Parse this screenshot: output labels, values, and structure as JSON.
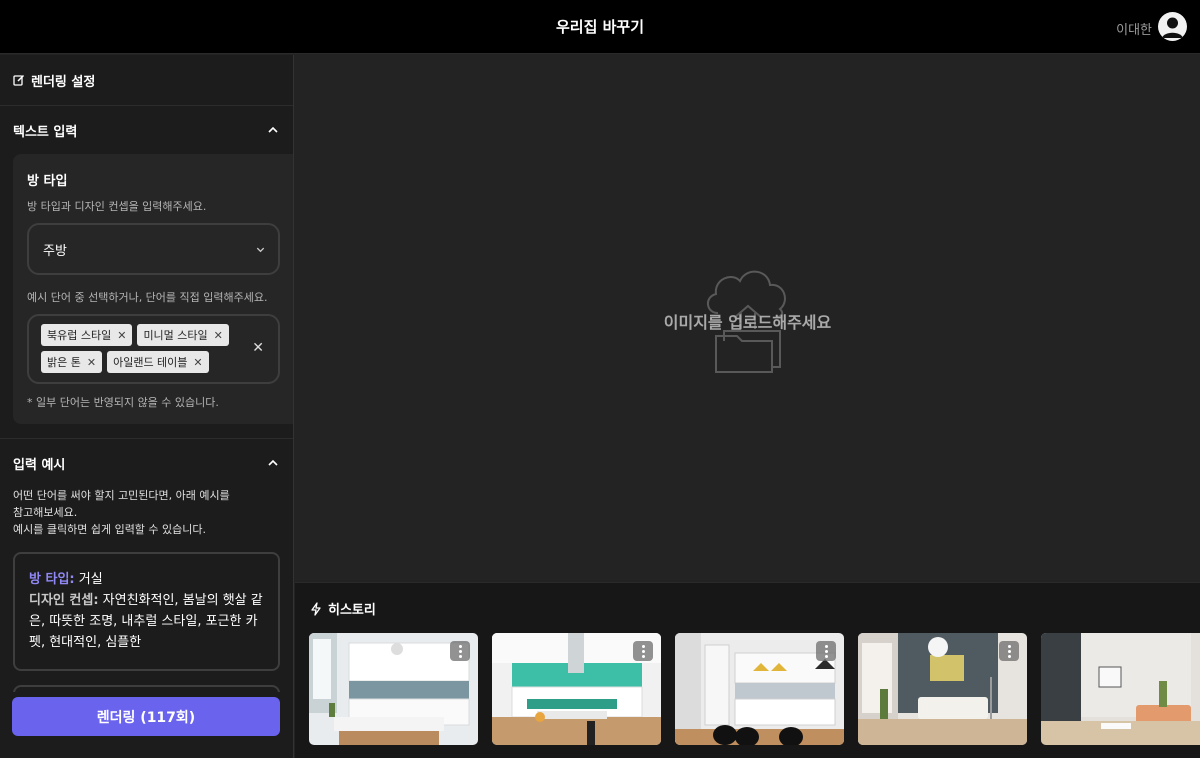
{
  "header": {
    "title": "우리집 바꾸기",
    "user_name": "이대한"
  },
  "sidebar": {
    "title": "렌더링 설정",
    "text_input": {
      "section_title": "텍스트 입력",
      "room_type_title": "방 타입",
      "room_type_hint": "방 타입과 디자인 컨셉을 입력해주세요.",
      "room_type_value": "주방",
      "keyword_hint": "예시 단어 중 선택하거나, 단어를 직접 입력해주세요.",
      "tags": [
        "북유럽 스타일",
        "미니멀 스타일",
        "밝은 톤",
        "아일랜드 테이블"
      ],
      "note": "* 일부 단어는 반영되지 않을 수 있습니다."
    },
    "examples": {
      "section_title": "입력 예시",
      "desc_line1": "어떤 단어를 써야 할지 고민된다면, 아래 예시를",
      "desc_line2": "참고해보세요.",
      "desc_line3": "예시를 클릭하면 쉽게 입력할 수 있습니다.",
      "example1": {
        "room_label": "방 타입:",
        "room_value": "거실",
        "concept_label": "디자인 컨셉:",
        "concept_value": "자연친화적인, 봄날의 햇살 같은, 따뜻한 조명, 내추럴 스타일, 포근한 카펫, 현대적인, 심플한"
      }
    },
    "render_button": "렌더링 (117회)"
  },
  "main": {
    "upload_text": "이미지를 업로드해주세요"
  },
  "history": {
    "title": "히스토리"
  },
  "colors": {
    "accent": "#6a63ee",
    "label_blue": "#8f88f5"
  }
}
